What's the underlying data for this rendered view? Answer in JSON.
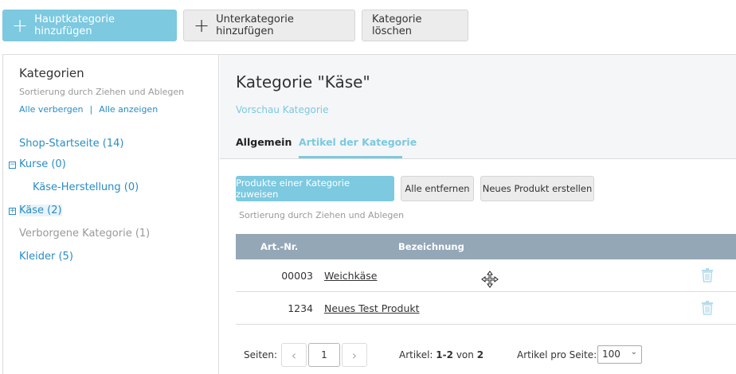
{
  "toolbar": {
    "add_main": "Hauptkategorie hinzufügen",
    "add_sub": "Unterkategorie hinzufügen",
    "delete": "Kategorie löschen"
  },
  "sidebar": {
    "title": "Kategorien",
    "hint": "Sortierung durch Ziehen und Ablegen",
    "hide_all": "Alle verbergen",
    "separator": "|",
    "show_all": "Alle anzeigen",
    "items": [
      {
        "label": "Shop-Startseite (14)"
      },
      {
        "label": "Kurse (0)",
        "toggle": "−"
      },
      {
        "label": "Käse-Herstellung (0)"
      },
      {
        "label": "Käse (2)",
        "toggle": "+"
      },
      {
        "label": "Verborgene Kategorie (1)"
      },
      {
        "label": "Kleider (5)"
      }
    ]
  },
  "main": {
    "title": "Kategorie \"Käse\"",
    "preview": "Vorschau Kategorie",
    "tabs": [
      {
        "label": "Allgemein"
      },
      {
        "label": "Artikel der Kategorie"
      }
    ],
    "assign_button": "Produkte einer Kategorie zuweisen",
    "remove_all_button": "Alle entfernen",
    "new_product_button": "Neues Produkt erstellen",
    "hint": "Sortierung durch Ziehen und Ablegen",
    "table": {
      "headers": [
        "Art.-Nr.",
        "Bezeichnung"
      ],
      "rows": [
        {
          "nr": "00003",
          "name": "Weichkäse"
        },
        {
          "nr": "1234",
          "name": "Neues Test Produkt"
        }
      ]
    },
    "pagination": {
      "pages_label": "Seiten:",
      "prev": "‹",
      "current": "1",
      "next": "›",
      "articles_label": "Artikel:",
      "range": "1-2",
      "of": "von",
      "total": "2",
      "per_page_label": "Artikel pro Seite:",
      "per_page_value": "100"
    }
  }
}
